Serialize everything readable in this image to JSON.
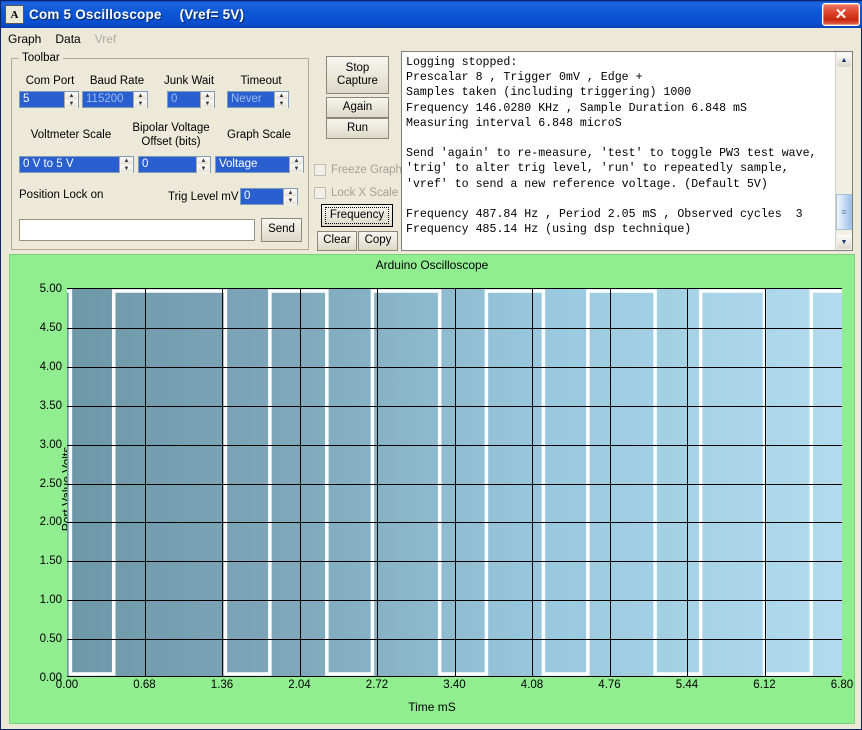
{
  "window": {
    "title_app": "Com  5 Oscilloscope",
    "title_vref": "(Vref= 5V)",
    "icon": "app-icon",
    "icon_glyph": "A",
    "close_label": "✕"
  },
  "menu": {
    "items": [
      {
        "label": "Graph",
        "enabled": true
      },
      {
        "label": "Data",
        "enabled": true
      },
      {
        "label": "Vref",
        "enabled": false
      }
    ]
  },
  "toolbar": {
    "legend": "Toolbar",
    "com_port": {
      "label": "Com Port",
      "value": "5"
    },
    "baud_rate": {
      "label": "Baud Rate",
      "value": "115200"
    },
    "junk_wait": {
      "label": "Junk Wait",
      "value": "0"
    },
    "timeout": {
      "label": "Timeout",
      "value": "Never"
    },
    "voltmeter_scale": {
      "label": "Voltmeter Scale",
      "value": "0 V to 5 V"
    },
    "bipolar_offset": {
      "label_line1": "Bipolar Voltage",
      "label_line2": "Offset (bits)",
      "value": "0"
    },
    "graph_scale": {
      "label": "Graph Scale",
      "value": "Voltage"
    },
    "position_lock": "Position Lock on",
    "trig_level": {
      "label": "Trig Level mV",
      "value": "0"
    },
    "command_input": {
      "value": "",
      "placeholder": ""
    },
    "send_label": "Send"
  },
  "controls": {
    "stop_capture": "Stop\nCapture",
    "stop_capture_line1": "Stop",
    "stop_capture_line2": "Capture",
    "again": "Again",
    "run": "Run",
    "freeze_graph": "Freeze Graph",
    "lock_x_scale": "Lock X Scale",
    "frequency": "Frequency",
    "clear": "Clear",
    "copy": "Copy"
  },
  "log": {
    "lines": [
      "Logging stopped:",
      "Prescalar 8 , Trigger 0mV , Edge +",
      "Samples taken (including triggering) 1000",
      "Frequency 146.0280 KHz , Sample Duration 6.848 mS",
      "Measuring interval 6.848 microS",
      "",
      "Send 'again' to re-measure, 'test' to toggle PW3 test wave,",
      "'trig' to alter trig level, 'run' to repeatedly sample,",
      "'vref' to send a new reference voltage. (Default 5V)",
      "",
      "Frequency 487.84 Hz , Period 2.05 mS , Observed cycles  3",
      "Frequency 485.14 Hz (using dsp technique)"
    ],
    "scroll_up": "▲",
    "scroll_down": "▼"
  },
  "chart_data": {
    "type": "line",
    "title": "Arduino Oscilloscope",
    "xlabel": "Time mS",
    "ylabel": "Port Value Volts",
    "xlim": [
      0.0,
      6.8
    ],
    "ylim": [
      0.0,
      5.0
    ],
    "grid": true,
    "legend": "none",
    "xticks": [
      "0.00",
      "0.68",
      "1.36",
      "2.04",
      "2.72",
      "3.40",
      "4.08",
      "4.76",
      "5.44",
      "6.12",
      "6.80"
    ],
    "xtick_values": [
      0.0,
      0.68,
      1.36,
      2.04,
      2.72,
      3.4,
      4.08,
      4.76,
      5.44,
      6.12,
      6.8
    ],
    "yticks": [
      "0.00",
      "0.50",
      "1.00",
      "1.50",
      "2.00",
      "2.50",
      "3.00",
      "3.50",
      "4.00",
      "4.50",
      "5.00"
    ],
    "ytick_values": [
      0.0,
      0.5,
      1.0,
      1.5,
      2.0,
      2.5,
      3.0,
      3.5,
      4.0,
      4.5,
      5.0
    ],
    "series": [
      {
        "name": "Port Value",
        "color": "#ffffff",
        "waveform": "square",
        "high_v": 5.0,
        "low_v": 0.0,
        "x": [
          0.0,
          0.03,
          0.03,
          0.41,
          0.41,
          1.39,
          1.39,
          1.78,
          1.78,
          2.28,
          2.28,
          2.68,
          2.68,
          3.27,
          3.27,
          3.68,
          3.68,
          4.18,
          4.18,
          4.57,
          4.57,
          5.16,
          5.16,
          5.56,
          5.56,
          6.12,
          6.12,
          6.53,
          6.53,
          6.8
        ],
        "y": [
          5.0,
          5.0,
          0.0,
          0.0,
          5.0,
          5.0,
          0.0,
          0.0,
          5.0,
          5.0,
          0.0,
          0.0,
          5.0,
          5.0,
          0.0,
          0.0,
          5.0,
          5.0,
          0.0,
          0.0,
          5.0,
          5.0,
          0.0,
          0.0,
          5.0,
          5.0,
          0.0,
          0.0,
          5.0,
          5.0
        ]
      }
    ],
    "plot_bg_left": "#6d98a8",
    "plot_bg_right": "#b2dced",
    "background": "#90ee90"
  }
}
